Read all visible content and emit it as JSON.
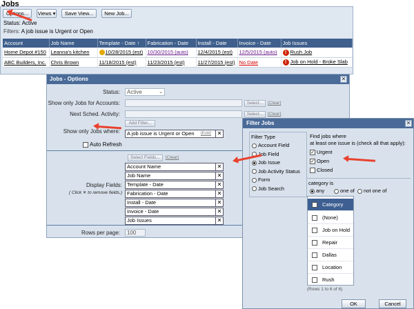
{
  "page_title": "Jobs",
  "toolbar": {
    "options_label": "Options...",
    "views_label": "Views ▾",
    "save_view_label": "Save View...",
    "new_job_label": "New Job..."
  },
  "status": {
    "status_label": "Status:",
    "status_value": "Active",
    "filters_label": "Filters:",
    "filters_value": "A job issue is Urgent or Open"
  },
  "jobs_table": {
    "columns": [
      "Account",
      "Job Name",
      "Template - Date ↑",
      "Fabrication - Date",
      "Install - Date",
      "Invoice - Date",
      "Job Issues"
    ],
    "rows": [
      {
        "account": "Home Depot #150",
        "job_name": "Leanna's kitchen",
        "template": "10/28/2015 (est)",
        "fabrication": "10/30/2015 (auto)",
        "install": "12/4/2015 (est)",
        "invoice": "12/5/2015 (auto)",
        "issue": "Rush Job"
      },
      {
        "account": "ABC Builders, Inc.",
        "job_name": "Chris Brown",
        "template": "11/18/2015 (est)",
        "fabrication": "11/23/2015 (est)",
        "install": "11/27/2015 (est)",
        "invoice": "No Date",
        "issue": "Job on Hold - Broke Slab"
      }
    ]
  },
  "options_dialog": {
    "title": "Jobs - Options",
    "close_glyph": "✕",
    "status_label": "Status:",
    "status_value": "Active",
    "accounts_label": "Show only Jobs for Accounts:",
    "activity_label": "Next Sched. Activity:",
    "select_button": "Select...",
    "clear_link": "[Clear]",
    "add_filter_button": "Add Filter...",
    "jobs_where_label": "Show only Jobs where:",
    "filter_chip": "A job issue is Urgent or Open",
    "edit_link": "[Edit]",
    "auto_refresh_label": "Auto Refresh",
    "select_fields_button": "Select Fields...",
    "display_fields_label": "Display Fields:",
    "display_fields_hint": "( Click ✕ to remove fields.)",
    "display_fields": [
      "Account Name",
      "Job Name",
      "Template - Date",
      "Fabrication - Date",
      "Install - Date",
      "Invoice - Date",
      "Job Issues"
    ],
    "rows_per_page_label": "Rows per page:",
    "rows_per_page_value": "100"
  },
  "filter_dialog": {
    "title": "Filter Jobs",
    "close_glyph": "✕",
    "filter_type_label": "Filter Type",
    "filter_types": [
      {
        "label": "Account Field",
        "selected": false
      },
      {
        "label": "Job Field",
        "selected": false
      },
      {
        "label": "Job Issue",
        "selected": true
      },
      {
        "label": "Job Activity Status",
        "selected": false
      },
      {
        "label": "Form",
        "selected": false
      },
      {
        "label": "Job Search",
        "selected": false
      }
    ],
    "find_label_1": "Find jobs where",
    "find_label_2": "at least one issue is (check all that apply):",
    "issue_options": [
      {
        "label": "Urgent",
        "checked": true
      },
      {
        "label": "Open",
        "checked": true
      },
      {
        "label": "Closed",
        "checked": false
      }
    ],
    "category_is_label": "category is",
    "match_options": [
      {
        "label": "any",
        "selected": true
      },
      {
        "label": "one of",
        "selected": false
      },
      {
        "label": "not one of",
        "selected": false
      }
    ],
    "category_header": "Category",
    "categories": [
      "(None)",
      "Job on Hold",
      "Repair",
      "Dallas",
      "Location",
      "Rush"
    ],
    "rows_info": "(Rows 1 to 6 of 6)",
    "ok_button": "OK",
    "cancel_button": "Cancel"
  },
  "colors": {
    "header_blue": "#3f5f8c",
    "dialog_title": "#4a6b98",
    "annotation_arrow": "#e8412e"
  }
}
